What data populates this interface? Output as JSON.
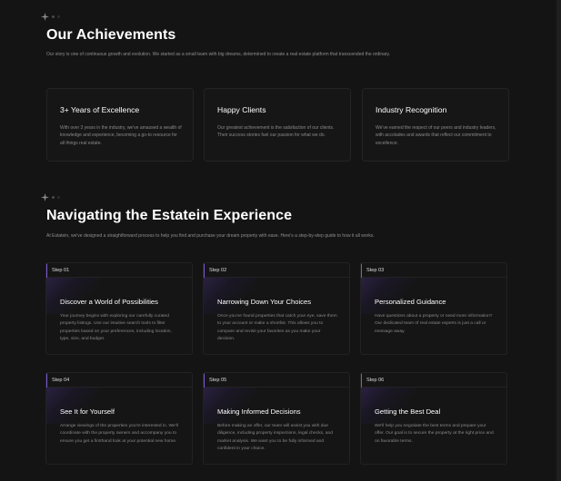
{
  "achievements": {
    "title": "Our Achievements",
    "description": "Our story is one of continuous growth and evolution. We started as a small team with big dreams, determined to create a real estate platform that transcended the ordinary.",
    "cards": [
      {
        "title": "3+ Years of Excellence",
        "text": "With over 3 years in the industry, we've amassed a wealth of knowledge and experience, becoming a go-to resource for all things real estate."
      },
      {
        "title": "Happy Clients",
        "text": "Our greatest achievement is the satisfaction of our clients. Their success stories fuel our passion for what we do."
      },
      {
        "title": "Industry Recognition",
        "text": "We've earned the respect of our peers and industry leaders, with accolades and awards that reflect our commitment to excellence."
      }
    ]
  },
  "navigating": {
    "title": "Navigating the Estatein Experience",
    "description": "At Estatein, we've designed a straightforward process to help you find and purchase your dream property with ease. Here's a step-by-step guide to how it all works.",
    "steps": [
      {
        "label": "Step 01",
        "title": "Discover a World of Possibilities",
        "text": "Your journey begins with exploring our carefully curated property listings. Use our intuitive search tools to filter properties based on your preferences, including location, type, size, and budget."
      },
      {
        "label": "Step 02",
        "title": "Narrowing Down Your Choices",
        "text": "Once you've found properties that catch your eye, save them to your account or make a shortlist. This allows you to compare and revisit your favorites as you make your decision."
      },
      {
        "label": "Step 03",
        "title": "Personalized Guidance",
        "text": "Have questions about a property or need more information? Our dedicated team of real estate experts is just a call or message away."
      },
      {
        "label": "Step 04",
        "title": "See It for Yourself",
        "text": "Arrange viewings of the properties you're interested in. We'll coordinate with the property owners and accompany you to ensure you get a firsthand look at your potential new home."
      },
      {
        "label": "Step 05",
        "title": "Making Informed Decisions",
        "text": "Before making an offer, our team will assist you with due diligence, including property inspections, legal checks, and market analysis. We want you to be fully informed and confident in your choice."
      },
      {
        "label": "Step 06",
        "title": "Getting the Best Deal",
        "text": "We'll help you negotiate the best terms and prepare your offer. Our goal is to secure the property at the right price and on favorable terms."
      }
    ]
  },
  "icons": {
    "decor": "sparkle-icon"
  },
  "colors": {
    "background": "#141414",
    "accent": "#7a5bd6"
  }
}
